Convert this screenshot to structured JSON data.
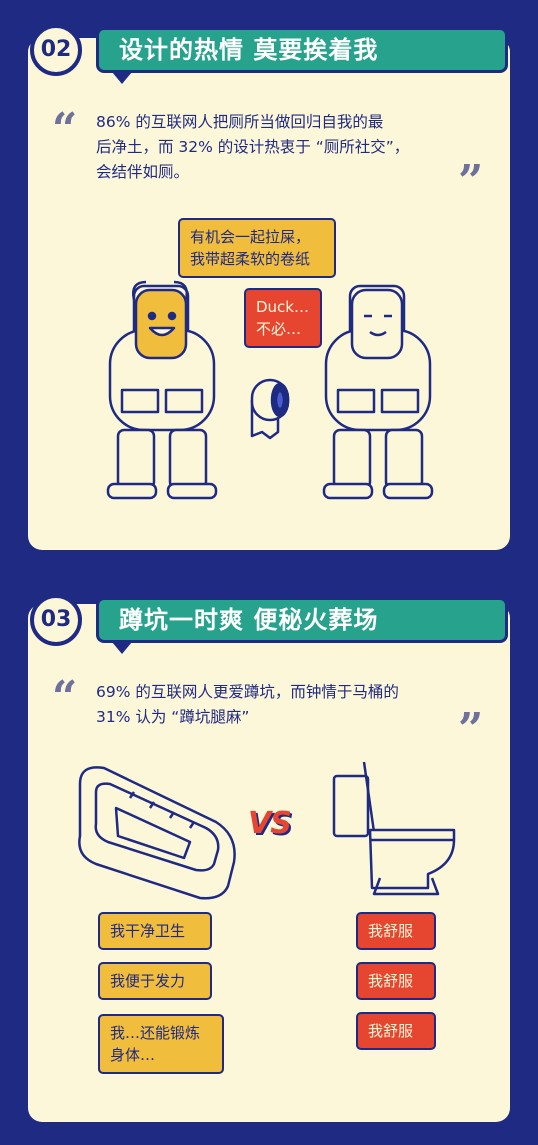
{
  "section2": {
    "number": "02",
    "title": "设计的热情 莫要挨着我",
    "quote_line1": "86% 的互联网人把厕所当做回归自我的最",
    "quote_line2": "后净土，而 32% 的设计热衷于 “厕所社交”，",
    "quote_line3": "会结伴如厕。",
    "bubble_yellow_line1": "有机会一起拉屎，",
    "bubble_yellow_line2": "我带超柔软的卷纸",
    "bubble_red_line1": "Duck…",
    "bubble_red_line2": "不必…"
  },
  "section3": {
    "number": "03",
    "title": "蹲坑一时爽 便秘火葬场",
    "quote_line1": "69% 的互联网人更爱蹲坑，而钟情于马桶的",
    "quote_line2": "31% 认为 “蹲坑腿麻”",
    "vs_label": "VS",
    "squat_reasons": [
      "我干净卫生",
      "我便于发力",
      "我…还能锻炼\n身体…"
    ],
    "toilet_reasons": [
      "我舒服",
      "我舒服",
      "我舒服"
    ]
  },
  "colors": {
    "navy": "#1f2a83",
    "cream": "#fdf7da",
    "teal": "#27a38d",
    "yellow": "#f1bd3d",
    "red": "#e6462f"
  }
}
